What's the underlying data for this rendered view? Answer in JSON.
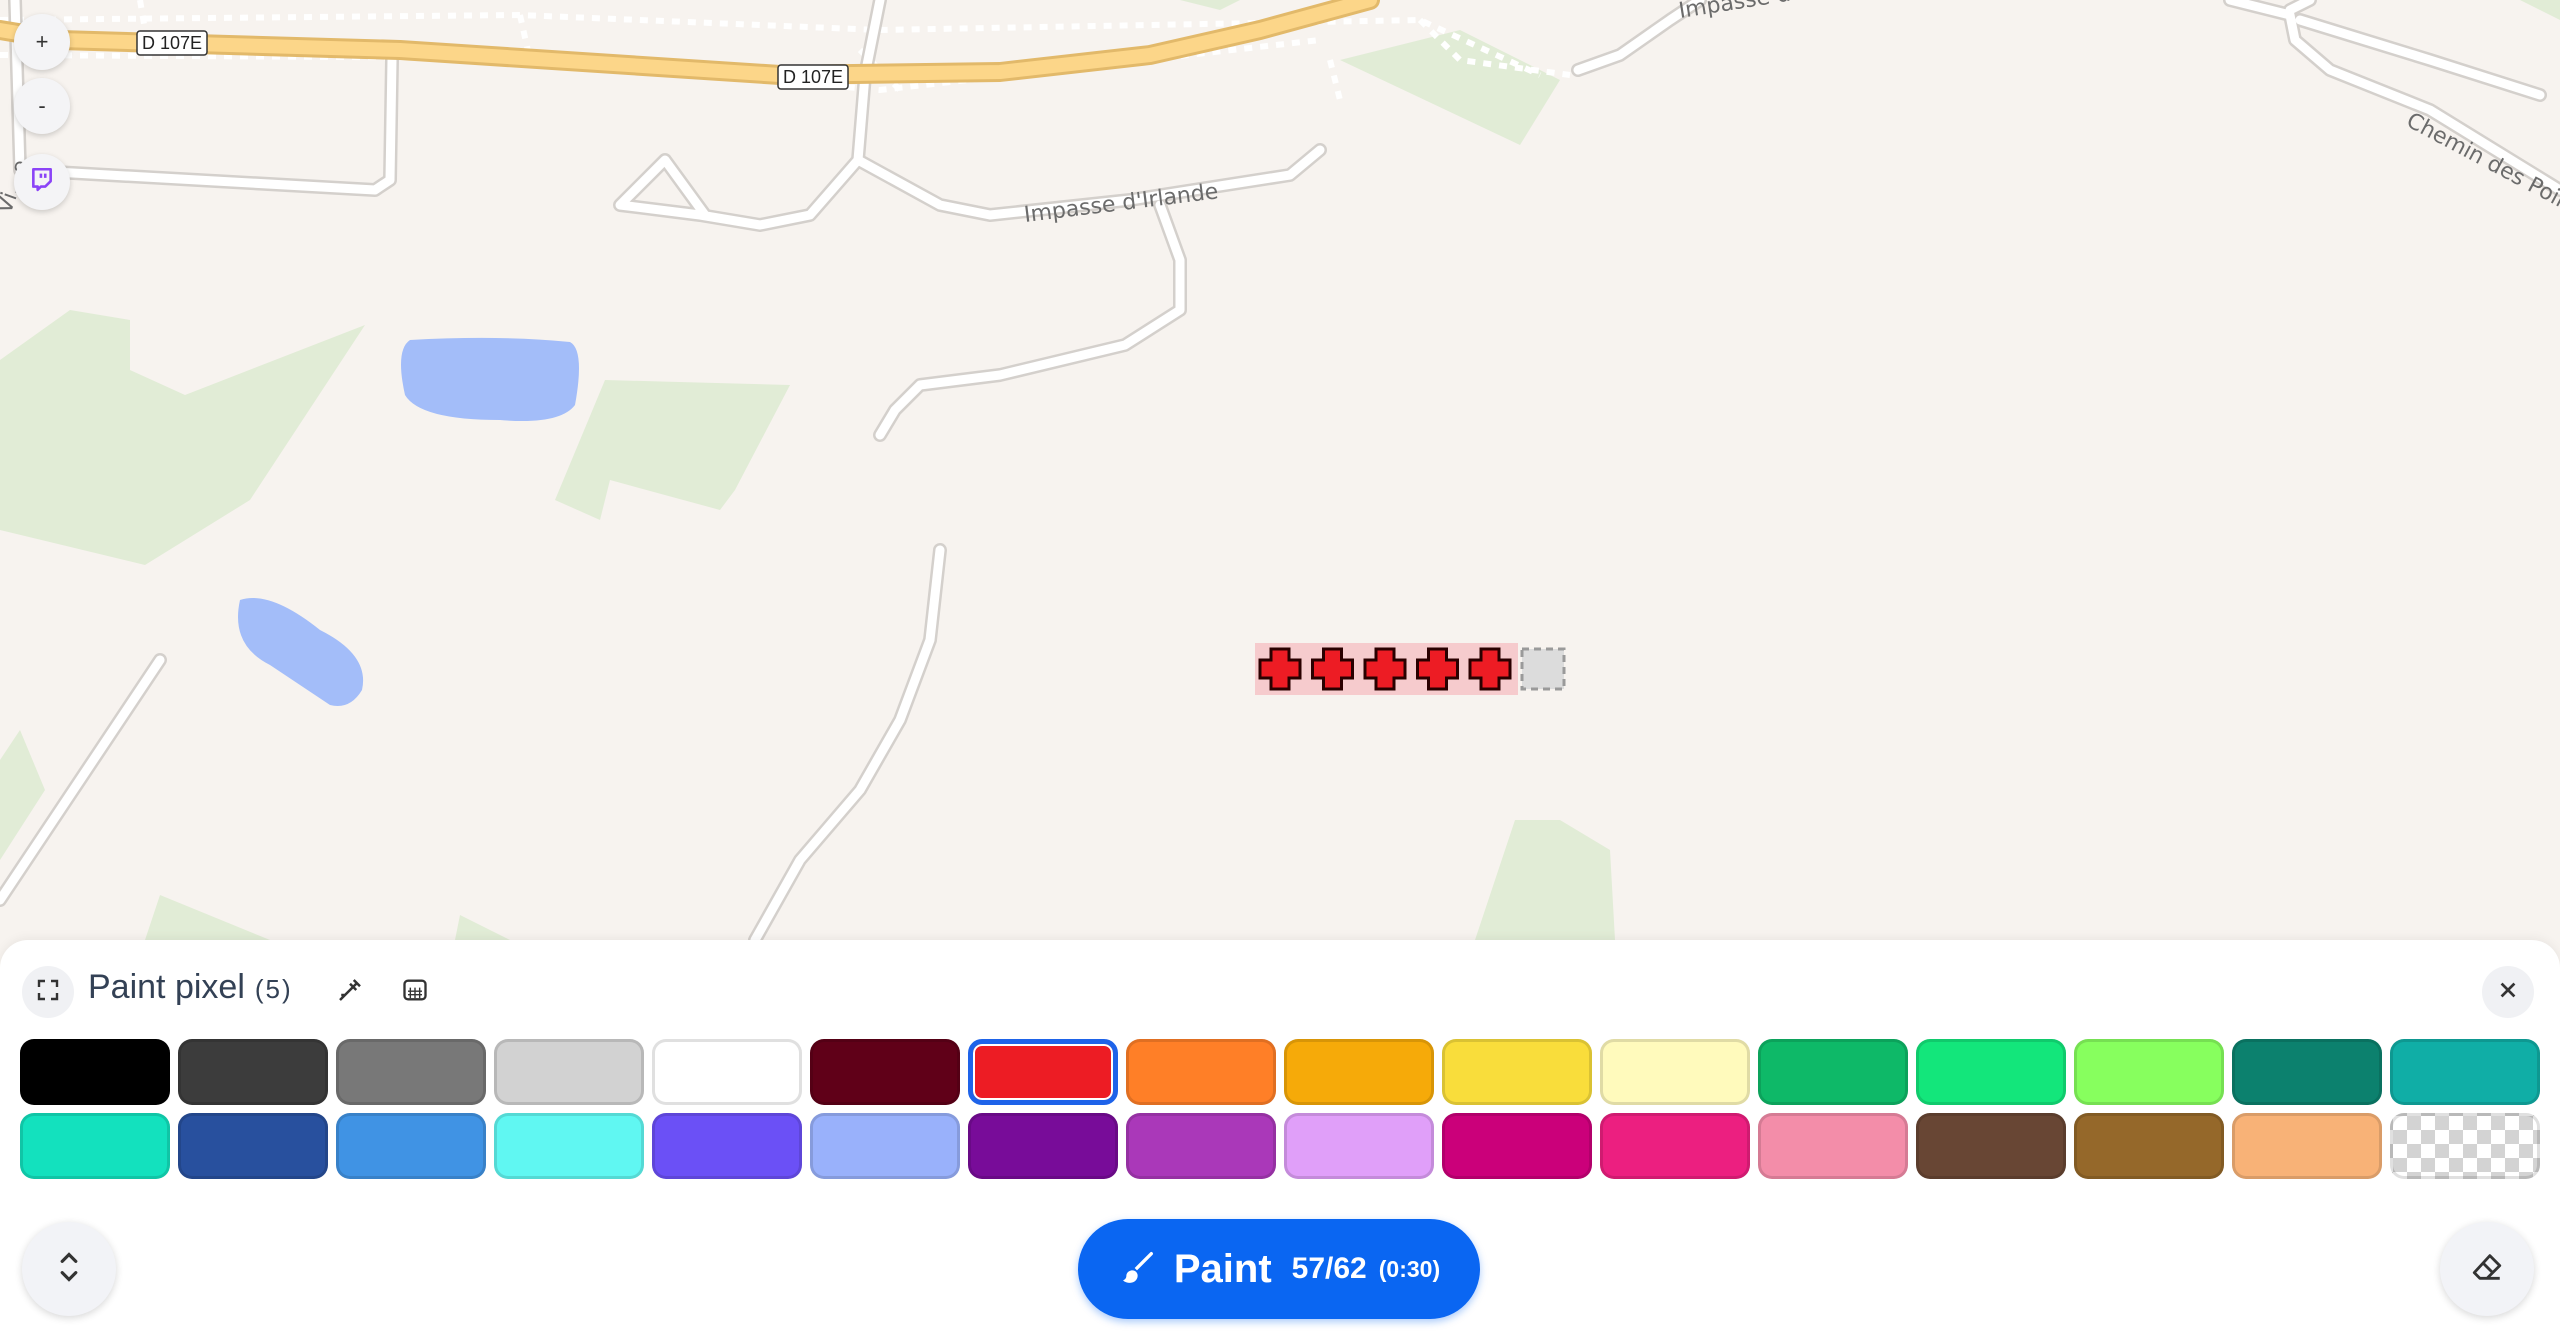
{
  "map": {
    "labels": {
      "impasse_irlande": "Impasse d'Irlande",
      "impasse_lux": "Impasse du Luxe",
      "chemin_des_poir": "Chemin des Poir",
      "vi_road": "Vi...e"
    },
    "route_shields": [
      "D 107E",
      "D 107E"
    ],
    "painted_pixels": 5,
    "painted_color": "#ed1c24",
    "colors": {
      "background": "#f7f3ef",
      "park": "#e1ecd6",
      "water": "#a3bdf9",
      "road_main": "#fcd689",
      "road_minor": "#ffffff"
    }
  },
  "controls": {
    "zoom_in": "+",
    "zoom_out": "-"
  },
  "panel": {
    "title": "Paint pixel",
    "count": "(5)",
    "palette": [
      {
        "name": "black",
        "hex": "#000000"
      },
      {
        "name": "dark-gray",
        "hex": "#3c3c3c"
      },
      {
        "name": "gray",
        "hex": "#787878"
      },
      {
        "name": "light-gray",
        "hex": "#d2d2d2"
      },
      {
        "name": "white",
        "hex": "#ffffff"
      },
      {
        "name": "deep-red",
        "hex": "#600018"
      },
      {
        "name": "red",
        "hex": "#ed1c24",
        "selected": true
      },
      {
        "name": "orange",
        "hex": "#ff7f27"
      },
      {
        "name": "gold",
        "hex": "#f6aa09"
      },
      {
        "name": "yellow",
        "hex": "#f9dd3b"
      },
      {
        "name": "light-yellow",
        "hex": "#fffabc"
      },
      {
        "name": "dark-green",
        "hex": "#0eb968"
      },
      {
        "name": "green",
        "hex": "#13e67b"
      },
      {
        "name": "light-green",
        "hex": "#87ff5e"
      },
      {
        "name": "dark-teal",
        "hex": "#0c816e"
      },
      {
        "name": "teal",
        "hex": "#10aea6"
      },
      {
        "name": "light-teal",
        "hex": "#13e1be"
      },
      {
        "name": "dark-blue",
        "hex": "#28509e"
      },
      {
        "name": "blue",
        "hex": "#4093e4"
      },
      {
        "name": "cyan",
        "hex": "#60f7f2"
      },
      {
        "name": "indigo",
        "hex": "#6b50f6"
      },
      {
        "name": "light-indigo",
        "hex": "#99b1fb"
      },
      {
        "name": "dark-purple",
        "hex": "#780c99"
      },
      {
        "name": "purple",
        "hex": "#aa38b9"
      },
      {
        "name": "light-purple",
        "hex": "#e09ff9"
      },
      {
        "name": "dark-pink",
        "hex": "#cb007a"
      },
      {
        "name": "pink",
        "hex": "#ec1f80"
      },
      {
        "name": "light-pink",
        "hex": "#f38da9"
      },
      {
        "name": "dark-brown",
        "hex": "#684634"
      },
      {
        "name": "brown",
        "hex": "#95682a"
      },
      {
        "name": "beige",
        "hex": "#f8b277"
      },
      {
        "name": "transparent",
        "hex": "transparent"
      }
    ]
  },
  "paint_button": {
    "label": "Paint",
    "charges": "57/62",
    "timer": "(0:30)",
    "color": "#0a66f2"
  },
  "icons": {
    "twitch": "twitch-icon",
    "expand": "expand-icon",
    "eyedropper": "eyedropper-icon",
    "template": "template-icon",
    "close": "close-icon",
    "collapse": "chevron-up-down-icon",
    "eraser": "eraser-icon",
    "brush": "brush-icon"
  }
}
